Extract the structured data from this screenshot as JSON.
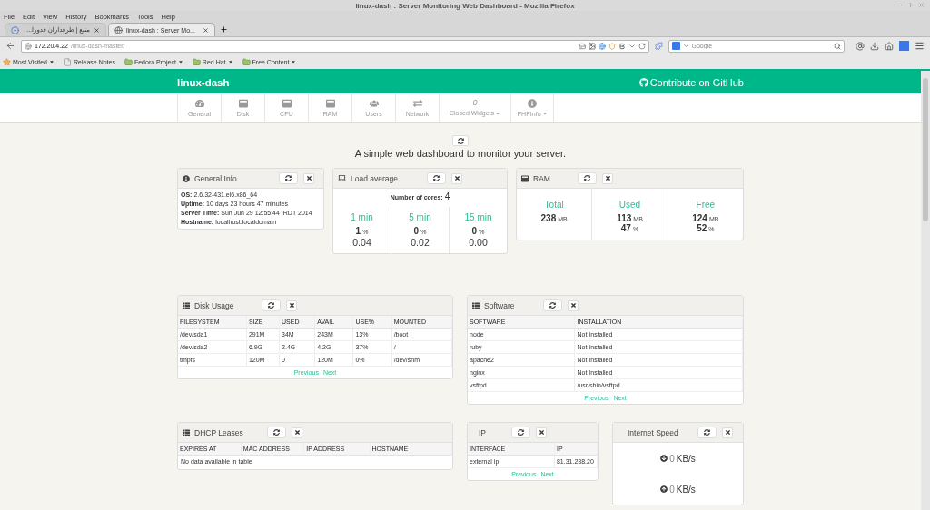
{
  "window": {
    "title": "linux-dash : Server Monitoring Web Dashboard - Mozilla Firefox"
  },
  "menu": [
    "File",
    "Edit",
    "View",
    "History",
    "Bookmarks",
    "Tools",
    "Help"
  ],
  "tabs": [
    {
      "label": "منبع | طرفداران فدورا...",
      "selected": false
    },
    {
      "label": "linux-dash : Server Mo...",
      "selected": true
    }
  ],
  "address_bar": {
    "host": "172.20.4.22",
    "path": "/linux-dash-master/"
  },
  "search": {
    "placeholder": "Google"
  },
  "bookmarks": [
    {
      "label": "Most Visited",
      "kind": "history",
      "dropdown": true
    },
    {
      "label": "Release Notes",
      "kind": "page",
      "dropdown": false
    },
    {
      "label": "Fedora Project",
      "kind": "folder",
      "dropdown": true
    },
    {
      "label": "Red Hat",
      "kind": "folder",
      "dropdown": true
    },
    {
      "label": "Free Content",
      "kind": "folder",
      "dropdown": true
    }
  ],
  "app": {
    "brand": "linux-dash",
    "github_link": "Contribute on GitHub"
  },
  "nav": [
    {
      "label": "General",
      "kind": "page",
      "dropdown": false
    },
    {
      "label": "Disk",
      "kind": "page",
      "dropdown": false
    },
    {
      "label": "CPU",
      "kind": "page",
      "dropdown": false
    },
    {
      "label": "RAM",
      "kind": "page",
      "dropdown": false
    },
    {
      "label": "Users",
      "kind": "page",
      "dropdown": false
    },
    {
      "label": "Network",
      "kind": "page",
      "dropdown": false
    },
    {
      "label": "Closed Widgets",
      "kind": "counter",
      "count": "0",
      "dropdown": true
    },
    {
      "label": "PHPInfo",
      "kind": "page",
      "dropdown": true
    }
  ],
  "tagline": "A simple web dashboard to monitor your server.",
  "general_info": {
    "title": "General Info",
    "fields": [
      {
        "label": "OS:",
        "value": "2.6.32-431.el6.x86_64"
      },
      {
        "label": "Uptime:",
        "value": "10 days 23 hours 47 minutes"
      },
      {
        "label": "Server Time:",
        "value": "Sun Jun 29 12:55:44 IRDT 2014"
      },
      {
        "label": "Hostname:",
        "value": "localhost.localdomain"
      }
    ]
  },
  "load_average": {
    "title": "Load average",
    "cores_label": "Number of cores:",
    "cores": "4",
    "periods": [
      {
        "label": "1 min",
        "percent": "1",
        "percent_unit": "%",
        "load": "0.04"
      },
      {
        "label": "5 min",
        "percent": "0",
        "percent_unit": "%",
        "load": "0.02"
      },
      {
        "label": "15 min",
        "percent": "0",
        "percent_unit": "%",
        "load": "0.00"
      }
    ]
  },
  "ram": {
    "title": "RAM",
    "stats": [
      {
        "label": "Total",
        "value": "238",
        "unit": "MB"
      },
      {
        "label": "Used",
        "value": "113",
        "unit": "MB",
        "percent": "47",
        "percent_unit": "%"
      },
      {
        "label": "Free",
        "value": "124",
        "unit": "MB",
        "percent": "52",
        "percent_unit": "%"
      }
    ]
  },
  "disk_usage": {
    "title": "Disk Usage",
    "columns": [
      "FILESYSTEM",
      "SIZE",
      "USED",
      "AVAIL",
      "USE%",
      "MOUNTED"
    ],
    "rows": [
      [
        "/dev/sda1",
        "291M",
        "34M",
        "243M",
        "13%",
        "/boot"
      ],
      [
        "/dev/sda2",
        "6.9G",
        "2.4G",
        "4.2G",
        "37%",
        "/"
      ],
      [
        "tmpfs",
        "120M",
        "0",
        "120M",
        "0%",
        "/dev/shm"
      ]
    ],
    "pager": [
      "Previous",
      "Next"
    ]
  },
  "software": {
    "title": "Software",
    "columns": [
      "SOFTWARE",
      "INSTALLATION"
    ],
    "rows": [
      [
        "node",
        "Not Installed"
      ],
      [
        "ruby",
        "Not Installed"
      ],
      [
        "apache2",
        "Not Installed"
      ],
      [
        "nginx",
        "Not Installed"
      ],
      [
        "vsftpd",
        "/usr/sbin/vsftpd"
      ]
    ],
    "pager": [
      "Previous",
      "Next"
    ]
  },
  "dhcp_leases": {
    "title": "DHCP Leases",
    "columns": [
      "EXPIRES AT",
      "MAC ADDRESS",
      "IP ADDRESS",
      "HOSTNAME"
    ],
    "empty": "No data available in table"
  },
  "ip": {
    "title": "IP",
    "columns": [
      "INTERFACE",
      "IP"
    ],
    "rows": [
      [
        "external ip",
        "81.31.238.20"
      ]
    ],
    "pager": [
      "Previous",
      "Next"
    ]
  },
  "internet_speed": {
    "title": "Internet Speed",
    "readings": [
      {
        "kind": "download",
        "value": "0",
        "unit": "KB/s"
      },
      {
        "kind": "upload",
        "value": "0",
        "unit": "KB/s"
      }
    ]
  }
}
